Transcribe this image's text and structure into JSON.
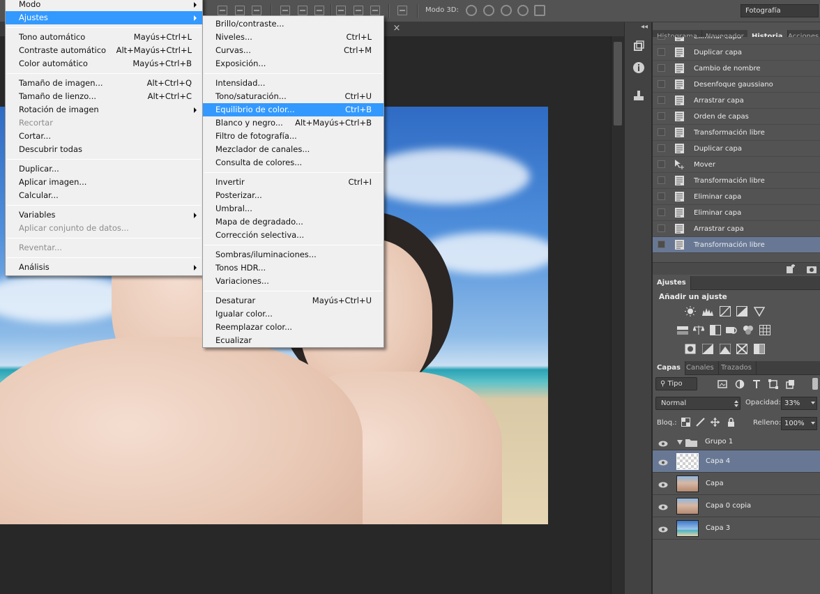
{
  "image_menu": {
    "items": [
      {
        "label": "Modo",
        "submenu": true
      },
      {
        "label": "Ajustes",
        "submenu": true,
        "highlighted": true
      },
      {
        "separator": true
      },
      {
        "label": "Tono automático",
        "shortcut": "Mayús+Ctrl+L"
      },
      {
        "label": "Contraste automático",
        "shortcut": "Alt+Mayús+Ctrl+L"
      },
      {
        "label": "Color automático",
        "shortcut": "Mayús+Ctrl+B"
      },
      {
        "separator": true
      },
      {
        "label": "Tamaño de imagen...",
        "shortcut": "Alt+Ctrl+Q"
      },
      {
        "label": "Tamaño de lienzo...",
        "shortcut": "Alt+Ctrl+C"
      },
      {
        "label": "Rotación de imagen",
        "submenu": true
      },
      {
        "label": "Recortar",
        "disabled": true
      },
      {
        "label": "Cortar..."
      },
      {
        "label": "Descubrir todas"
      },
      {
        "separator": true
      },
      {
        "label": "Duplicar..."
      },
      {
        "label": "Aplicar imagen..."
      },
      {
        "label": "Calcular..."
      },
      {
        "separator": true
      },
      {
        "label": "Variables",
        "submenu": true
      },
      {
        "label": "Aplicar conjunto de datos...",
        "disabled": true
      },
      {
        "separator": true
      },
      {
        "label": "Reventar...",
        "disabled": true
      },
      {
        "separator": true
      },
      {
        "label": "Análisis",
        "submenu": true
      }
    ]
  },
  "adjust_menu": {
    "items": [
      {
        "label": "Brillo/contraste..."
      },
      {
        "label": "Niveles...",
        "shortcut": "Ctrl+L"
      },
      {
        "label": "Curvas...",
        "shortcut": "Ctrl+M"
      },
      {
        "label": "Exposición..."
      },
      {
        "separator": true
      },
      {
        "label": "Intensidad..."
      },
      {
        "label": "Tono/saturación...",
        "shortcut": "Ctrl+U"
      },
      {
        "label": "Equilibrio de color...",
        "shortcut": "Ctrl+B",
        "highlighted": true
      },
      {
        "label": "Blanco y negro...",
        "shortcut": "Alt+Mayús+Ctrl+B"
      },
      {
        "label": "Filtro de fotografía..."
      },
      {
        "label": "Mezclador de canales..."
      },
      {
        "label": "Consulta de colores..."
      },
      {
        "separator": true
      },
      {
        "label": "Invertir",
        "shortcut": "Ctrl+I"
      },
      {
        "label": "Posterizar..."
      },
      {
        "label": "Umbral..."
      },
      {
        "label": "Mapa de degradado..."
      },
      {
        "label": "Corrección selectiva..."
      },
      {
        "separator": true
      },
      {
        "label": "Sombras/iluminaciones..."
      },
      {
        "label": "Tonos HDR..."
      },
      {
        "label": "Variaciones..."
      },
      {
        "separator": true
      },
      {
        "label": "Desaturar",
        "shortcut": "Mayús+Ctrl+U"
      },
      {
        "label": "Igualar color..."
      },
      {
        "label": "Reemplazar color..."
      },
      {
        "label": "Ecualizar"
      }
    ]
  },
  "options_bar": {
    "mode3d_label": "Modo 3D:",
    "workspace": "Fotografía"
  },
  "doc": {
    "close_glyph": "×"
  },
  "history_panel": {
    "tabs": [
      {
        "label": "Histograma",
        "active": false
      },
      {
        "label": "Navegador",
        "active": false
      },
      {
        "label": "Historia",
        "active": true
      },
      {
        "label": "Acciones",
        "active": false
      }
    ],
    "states": [
      {
        "label": "Eliminar capa",
        "icon": "document-icon"
      },
      {
        "label": "Duplicar capa",
        "icon": "document-icon"
      },
      {
        "label": "Cambio de nombre",
        "icon": "document-icon"
      },
      {
        "label": "Desenfoque gaussiano",
        "icon": "document-icon"
      },
      {
        "label": "Arrastrar capa",
        "icon": "document-icon"
      },
      {
        "label": "Orden de capas",
        "icon": "document-icon"
      },
      {
        "label": "Transformación libre",
        "icon": "document-icon"
      },
      {
        "label": "Duplicar capa",
        "icon": "document-icon"
      },
      {
        "label": "Mover",
        "icon": "move-tool-icon"
      },
      {
        "label": "Transformación libre",
        "icon": "document-icon"
      },
      {
        "label": "Eliminar capa",
        "icon": "document-icon"
      },
      {
        "label": "Eliminar capa",
        "icon": "document-icon"
      },
      {
        "label": "Arrastrar capa",
        "icon": "document-icon"
      },
      {
        "label": "Transformación libre",
        "icon": "document-icon",
        "current": true
      }
    ]
  },
  "adjustments_panel": {
    "tab": "Ajustes",
    "title": "Añadir un ajuste"
  },
  "layers_panel": {
    "tabs": [
      {
        "label": "Capas",
        "active": true
      },
      {
        "label": "Canales",
        "active": false
      },
      {
        "label": "Trazados",
        "active": false
      }
    ],
    "kind_filter": "Tipo",
    "blend_mode": "Normal",
    "opacity_label": "Opacidad:",
    "opacity": "33%",
    "lock_label": "Bloq.:",
    "fill_label": "Relleno:",
    "fill": "100%",
    "layers": [
      {
        "name": "Grupo 1",
        "type": "group",
        "expanded": true
      },
      {
        "name": "Capa 4",
        "type": "transparent",
        "selected": true
      },
      {
        "name": "Capa",
        "type": "photo"
      },
      {
        "name": "Capa 0 copia",
        "type": "photo"
      },
      {
        "name": "Capa 3",
        "type": "sky"
      }
    ]
  },
  "colors": {
    "menu_highlight": "#3399ff",
    "selected_row": "#687894",
    "panel_bg": "#535353"
  }
}
